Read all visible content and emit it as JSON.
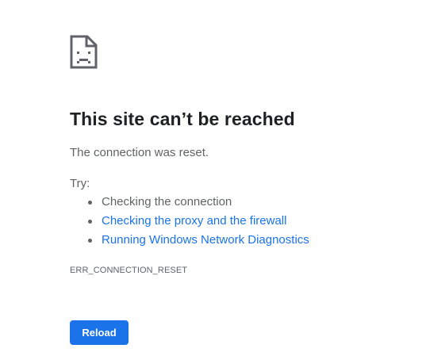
{
  "error": {
    "icon": "sad-document-icon",
    "title": "This site can’t be reached",
    "message": "The connection was reset.",
    "try_label": "Try:",
    "suggestions": [
      {
        "text": "Checking the connection",
        "link": false
      },
      {
        "text": "Checking the proxy and the firewall",
        "link": true
      },
      {
        "text": "Running Windows Network Diagnostics",
        "link": true
      }
    ],
    "code": "ERR_CONNECTION_RESET",
    "reload_label": "Reload"
  },
  "colors": {
    "title": "#202124",
    "body_text": "#5f6368",
    "link": "#1a73e8",
    "button_bg": "#1a73e8",
    "button_text": "#ffffff",
    "icon": "#5f6368"
  }
}
